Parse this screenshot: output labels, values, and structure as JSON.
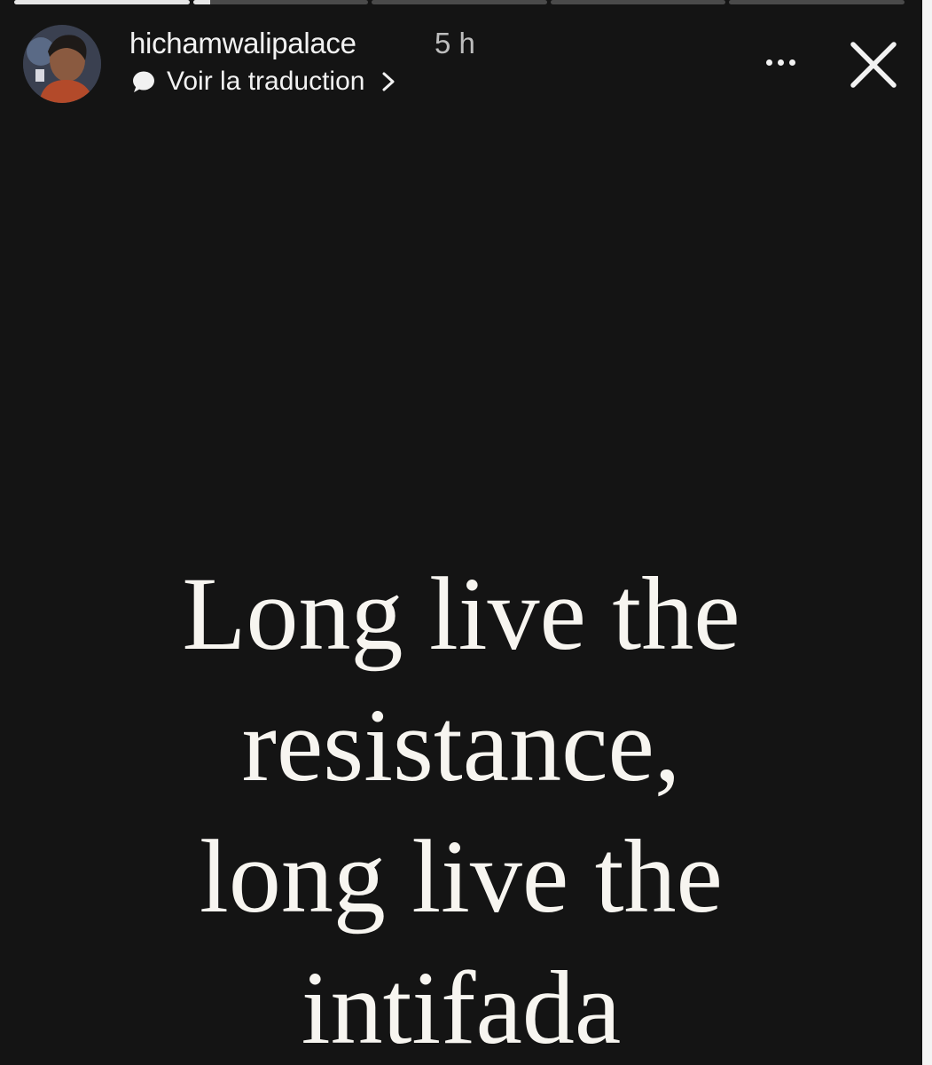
{
  "story": {
    "progress": [
      1,
      0.1,
      0,
      0,
      0
    ],
    "username": "hichamwalipalace",
    "time": "5 h",
    "translate_label": "Voir la traduction",
    "text_lines": [
      "Long live the",
      "resistance,",
      "long live the",
      "intifada"
    ]
  },
  "icons": {
    "avatar": "avatar",
    "translate": "speech-bubble-icon",
    "chevron": "chevron-right-icon",
    "more": "more-options-icon",
    "close": "close-icon"
  },
  "colors": {
    "background": "#141414",
    "text": "#f7f5f0",
    "muted": "#bdbdbd"
  }
}
